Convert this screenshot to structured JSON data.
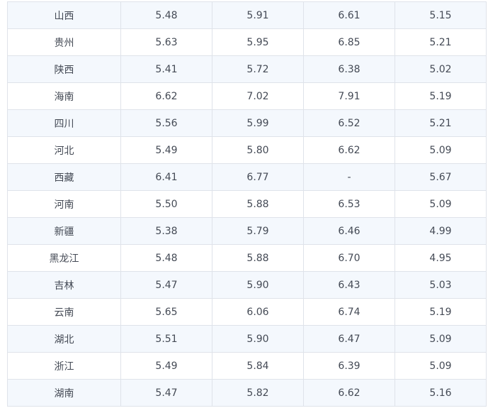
{
  "table": {
    "rows": [
      [
        "山西",
        "5.48",
        "5.91",
        "6.61",
        "5.15"
      ],
      [
        "贵州",
        "5.63",
        "5.95",
        "6.85",
        "5.21"
      ],
      [
        "陕西",
        "5.41",
        "5.72",
        "6.38",
        "5.02"
      ],
      [
        "海南",
        "6.62",
        "7.02",
        "7.91",
        "5.19"
      ],
      [
        "四川",
        "5.56",
        "5.99",
        "6.52",
        "5.21"
      ],
      [
        "河北",
        "5.49",
        "5.80",
        "6.62",
        "5.09"
      ],
      [
        "西藏",
        "6.41",
        "6.77",
        "-",
        "5.67"
      ],
      [
        "河南",
        "5.50",
        "5.88",
        "6.53",
        "5.09"
      ],
      [
        "新疆",
        "5.38",
        "5.79",
        "6.46",
        "4.99"
      ],
      [
        "黑龙江",
        "5.48",
        "5.88",
        "6.70",
        "4.95"
      ],
      [
        "吉林",
        "5.47",
        "5.90",
        "6.43",
        "5.03"
      ],
      [
        "云南",
        "5.65",
        "6.06",
        "6.74",
        "5.19"
      ],
      [
        "湖北",
        "5.51",
        "5.90",
        "6.47",
        "5.09"
      ],
      [
        "浙江",
        "5.49",
        "5.84",
        "6.39",
        "5.09"
      ],
      [
        "湖南",
        "5.47",
        "5.82",
        "6.62",
        "5.16"
      ]
    ]
  }
}
